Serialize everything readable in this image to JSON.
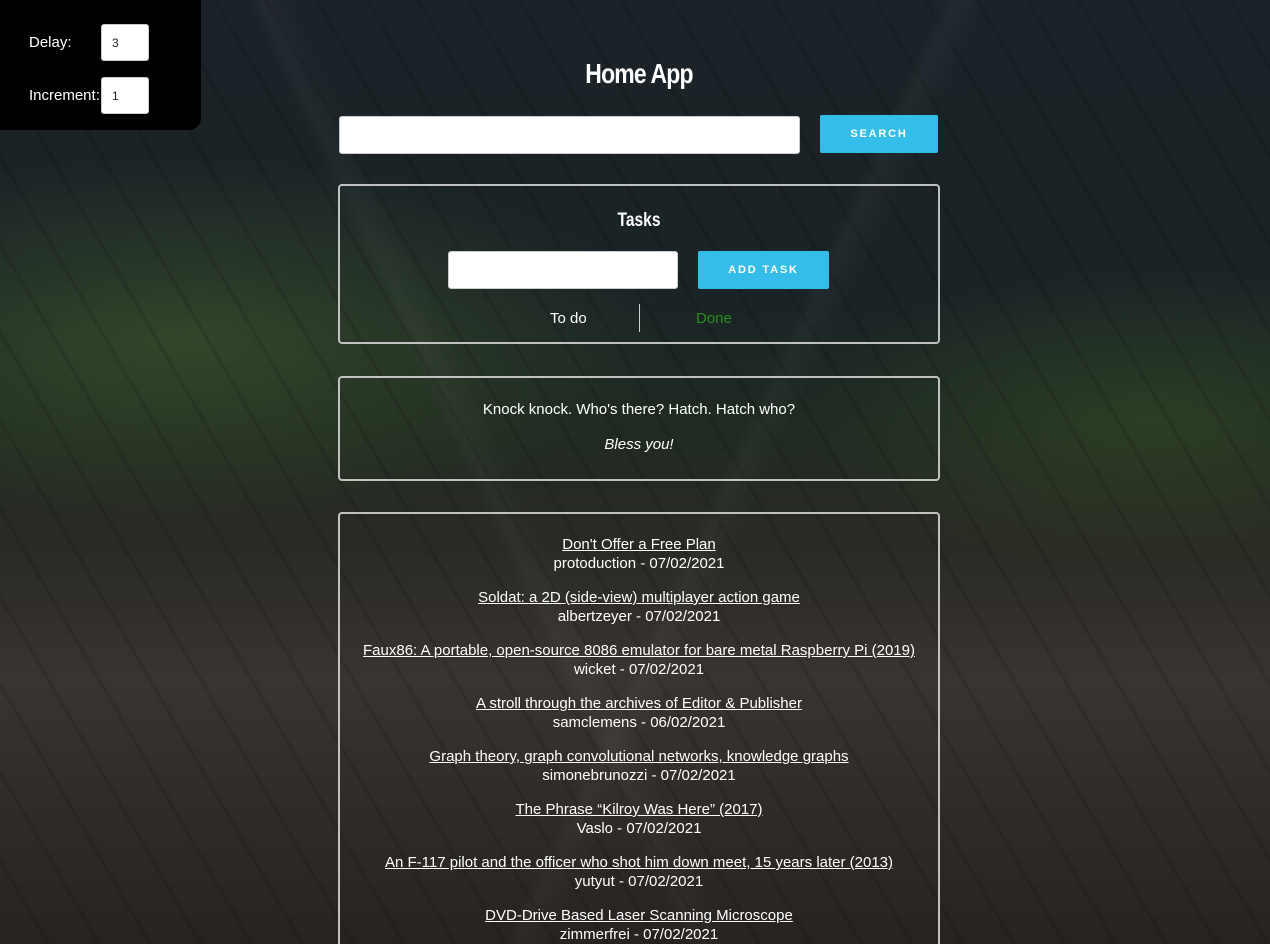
{
  "controls": {
    "delay_label": "Delay:",
    "delay_value": "3",
    "increment_label": "Increment:",
    "increment_value": "1"
  },
  "header": {
    "title": "Home App"
  },
  "search": {
    "value": "",
    "button_label": "SEARCH"
  },
  "tasks": {
    "title": "Tasks",
    "input_value": "",
    "add_button_label": "ADD TASK",
    "tab_todo": "To do",
    "tab_done": "Done"
  },
  "joke": {
    "setup": "Knock knock. Who's there? Hatch. Hatch who?",
    "punchline": "Bless you!"
  },
  "news": [
    {
      "title": "Don't Offer a Free Plan",
      "meta": "protoduction - 07/02/2021"
    },
    {
      "title": "Soldat: a 2D (side-view) multiplayer action game",
      "meta": "albertzeyer - 07/02/2021"
    },
    {
      "title": "Faux86: A portable, open-source 8086 emulator for bare metal Raspberry Pi (2019)",
      "meta": "wicket - 07/02/2021"
    },
    {
      "title": "A stroll through the archives of Editor & Publisher",
      "meta": "samclemens - 06/02/2021"
    },
    {
      "title": "Graph theory, graph convolutional networks, knowledge graphs",
      "meta": "simonebrunozzi - 07/02/2021"
    },
    {
      "title": "The Phrase “Kilroy Was Here” (2017)",
      "meta": "Vaslo - 07/02/2021"
    },
    {
      "title": "An F-117 pilot and the officer who shot him down meet, 15 years later (2013)",
      "meta": "yutyut - 07/02/2021"
    },
    {
      "title": "DVD-Drive Based Laser Scanning Microscope",
      "meta": "zimmerfrei - 07/02/2021"
    }
  ]
}
